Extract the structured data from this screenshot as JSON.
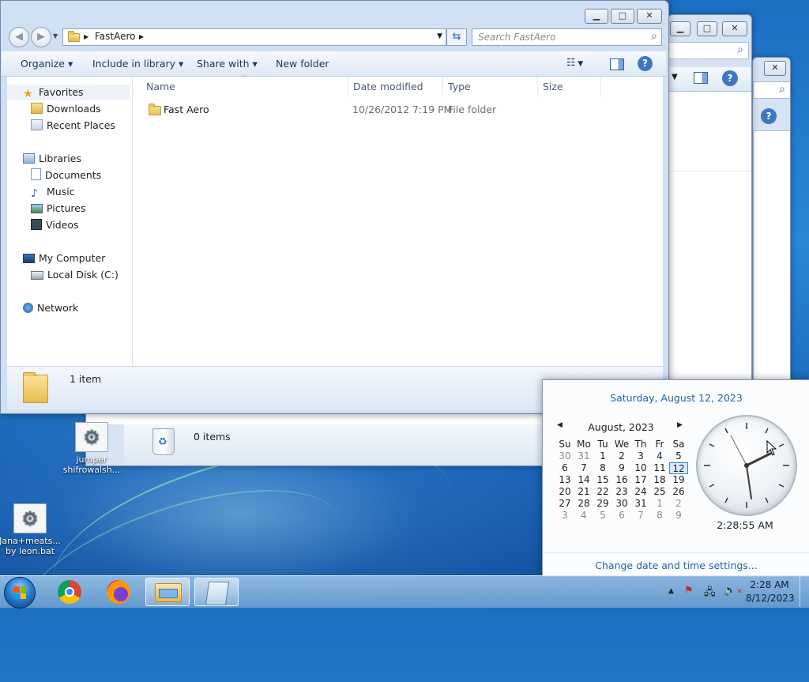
{
  "explorer": {
    "path_segment": "FastAero",
    "search_placeholder": "Search FastAero",
    "commands": {
      "organize": "Organize",
      "include_library": "Include in library",
      "share_with": "Share with",
      "new_folder": "New folder"
    },
    "nav": {
      "favorites": "Favorites",
      "downloads": "Downloads",
      "recent_places": "Recent Places",
      "libraries": "Libraries",
      "documents": "Documents",
      "music": "Music",
      "pictures": "Pictures",
      "videos": "Videos",
      "my_computer": "My Computer",
      "local_disk": "Local Disk (C:)",
      "network": "Network"
    },
    "columns": {
      "name": "Name",
      "date_modified": "Date modified",
      "type": "Type",
      "size": "Size"
    },
    "rows": [
      {
        "name": "Fast Aero",
        "date": "10/26/2012 7:19 PM",
        "type": "File folder"
      }
    ],
    "status": "1 item"
  },
  "recycle": {
    "status": "0 items"
  },
  "desktop_icons": [
    {
      "label": "jumper shifrowalsh..."
    },
    {
      "label": "Jana+meats... by leon.bat"
    }
  ],
  "calendar": {
    "long_date": "Saturday, August 12, 2023",
    "month_label": "August, 2023",
    "weekdays": [
      "Su",
      "Mo",
      "Tu",
      "We",
      "Th",
      "Fr",
      "Sa"
    ],
    "weeks": [
      [
        "30",
        "31",
        "1",
        "2",
        "3",
        "4",
        "5"
      ],
      [
        "6",
        "7",
        "8",
        "9",
        "10",
        "11",
        "12"
      ],
      [
        "13",
        "14",
        "15",
        "16",
        "17",
        "18",
        "19"
      ],
      [
        "20",
        "21",
        "22",
        "23",
        "24",
        "25",
        "26"
      ],
      [
        "27",
        "28",
        "29",
        "30",
        "31",
        "1",
        "2"
      ],
      [
        "3",
        "4",
        "5",
        "6",
        "7",
        "8",
        "9"
      ]
    ],
    "selected_day": "12",
    "clock_time": "2:28:55 AM",
    "settings_link": "Change date and time settings..."
  },
  "taskbar": {
    "time": "2:28 AM",
    "date": "8/12/2023"
  },
  "colors": {
    "link": "#2460a8",
    "selection": "#3c7fd5"
  },
  "icons": [
    "back-icon",
    "forward-icon",
    "folder-icon",
    "refresh-icon",
    "search-icon",
    "star-icon",
    "views-icon",
    "preview-pane-icon",
    "help-icon",
    "recycle-bin-icon",
    "chrome-icon",
    "firefox-icon",
    "explorer-icon",
    "notepad-icon",
    "network-tray-icon",
    "volume-muted-icon",
    "flag-icon"
  ]
}
